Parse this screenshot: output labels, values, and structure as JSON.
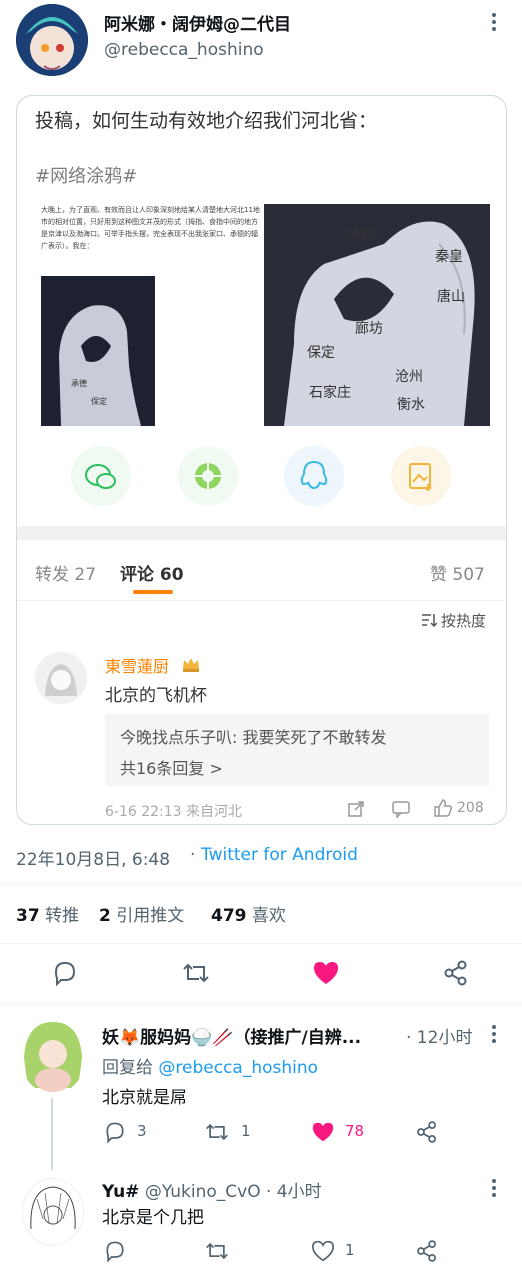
{
  "tweet": {
    "display_name": "阿米娜・阔伊姆@二代目",
    "handle": "@rebecca_hoshino",
    "timestamp": "22年10月8日, 6:48",
    "dot": "·",
    "source": "Twitter for Android",
    "stats": {
      "retweets_count": "37",
      "retweets_label": "转推",
      "quotes_count": "2",
      "quotes_label": "引用推文",
      "likes_count": "479",
      "likes_label": "喜欢"
    }
  },
  "embed": {
    "question": "投稿，如何生动有效地介绍我们河北省：",
    "hashtag": "#网络涂鸦#",
    "paragraph": "大晚上，为了直观、有效而且让人印象深刻地给某人清楚地大河北11地市的相对位置，只好用到这种图文并茂的形式（拇指、食指中间的地方是京津以及渤海口。可举手指头摆，完全表现不出我张家口、承德的辐广表示）。我在：",
    "right_hand_text": [
      "承德",
      "秦皇",
      "唐山",
      "廊坊",
      "保定",
      "沧州",
      "石家庄",
      "衡水"
    ],
    "tabs": {
      "repost": "转发 27",
      "comments": "评论 60",
      "likes": "赞 507"
    },
    "sort_label": "按热度",
    "comment": {
      "name": "東雪蓮厨",
      "text": "北京的飞机杯",
      "reply_preview": "今晚找点乐子叭: 我要笑死了不敢转发",
      "replies_link": "共16条回复 >",
      "meta": "6-16 22:13 来自河北",
      "like_count": "208"
    }
  },
  "replies": [
    {
      "name": "妖🦊服妈妈🍚🥢（接推广/自辨...",
      "time": "· 12小时",
      "reply_to_label": "回复给",
      "reply_to_handle": "@rebecca_hoshino",
      "text": "北京就是屌",
      "replies": "3",
      "retweets": "1",
      "likes": "78"
    },
    {
      "name": "Yu#",
      "handle": "@Yukino_CvO",
      "time": "· 4小时",
      "text": "北京是个几把",
      "likes": "1"
    }
  ],
  "colors": {
    "accent": "#1d9bf0",
    "like_pink": "#f91880",
    "weibo_orange": "#ff8200"
  },
  "icons": [
    "more-icon",
    "wechat-icon",
    "moments-icon",
    "qq-icon",
    "save-icon",
    "sort-icon",
    "share-icon",
    "comment-icon",
    "like-icon",
    "reply-icon",
    "retweet-icon",
    "heart-icon"
  ]
}
